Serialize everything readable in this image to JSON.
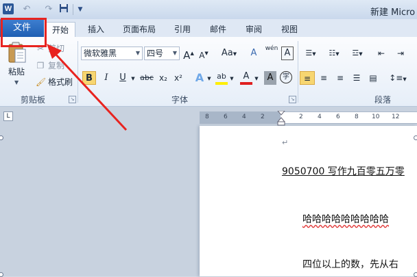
{
  "app": {
    "icon_letter": "W",
    "title": "新建 Micro"
  },
  "qat": {
    "undo_icon": "undo-icon",
    "redo_icon": "redo-icon",
    "save_icon": "save-icon",
    "customize_icon": "dropdown-icon"
  },
  "tabs": [
    {
      "label": "文件"
    },
    {
      "label": "开始"
    },
    {
      "label": "插入"
    },
    {
      "label": "页面布局"
    },
    {
      "label": "引用"
    },
    {
      "label": "邮件"
    },
    {
      "label": "审阅"
    },
    {
      "label": "视图"
    }
  ],
  "clipboard": {
    "paste": "粘贴",
    "cut": "剪切",
    "copy": "复制",
    "format_painter": "格式刷",
    "group_label": "剪贴板"
  },
  "font": {
    "name": "微软雅黑",
    "size": "四号",
    "grow": "A",
    "shrink": "A",
    "change_case": "Aa",
    "clear_format": "A",
    "phonetic": "wén",
    "border_char": "A",
    "bold": "B",
    "italic": "I",
    "underline": "U",
    "strike": "abc",
    "subscript": "x₂",
    "superscript": "x²",
    "text_effect": "A",
    "highlight": "ab",
    "font_color": "A",
    "shading": "A",
    "enclose": "字",
    "group_label": "字体"
  },
  "paragraph": {
    "group_label": "段落"
  },
  "ruler": {
    "corner": "L",
    "ticks": [
      "8",
      "6",
      "4",
      "2",
      "2",
      "4",
      "6",
      "8",
      "10",
      "12"
    ]
  },
  "document": {
    "paragraph_mark": "↵",
    "lines": [
      "9050700 写作九百零五万零",
      "哈哈哈哈哈哈哈哈哈",
      "四位以上的数，先从右"
    ]
  },
  "colors": {
    "file_tab": "#2a6ac4",
    "highlight_box": "#e8231f",
    "arrow": "#e8231f",
    "active_button": "#f7d671"
  }
}
